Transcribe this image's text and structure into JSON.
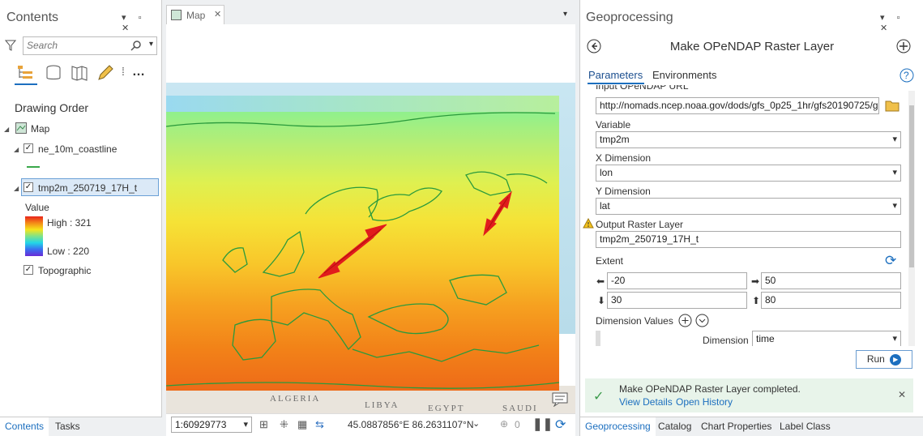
{
  "contents": {
    "title": "Contents",
    "search_placeholder": "Search",
    "drawing_order": "Drawing Order",
    "map_label": "Map",
    "layer1": "ne_10m_coastline",
    "layer2": "tmp2m_250719_17H_t",
    "value_label": "Value",
    "high": "High : 321",
    "low": "Low : 220",
    "layer3": "Topographic",
    "bottom_tabs": [
      "Contents",
      "Tasks"
    ]
  },
  "map": {
    "tab_label": "Map",
    "place_labels": [
      "ALGERIA",
      "LIBYA",
      "EGYPT",
      "SAUDI"
    ],
    "scale": "1:60929773",
    "coords": "45.0887856°E 86.2631107°N",
    "selected_count": "0"
  },
  "geoprocessing": {
    "title": "Geoprocessing",
    "tool_title": "Make OPeNDAP Raster Layer",
    "tabs": [
      "Parameters",
      "Environments"
    ],
    "input_label_partial": "Input OPeNDAP URL",
    "input_url": "http://nomads.ncep.noaa.gov/dods/gfs_0p25_1hr/gfs20190725/g",
    "variable_label": "Variable",
    "variable_value": "tmp2m",
    "xdim_label": "X Dimension",
    "xdim_value": "lon",
    "ydim_label": "Y Dimension",
    "ydim_value": "lat",
    "output_label": "Output Raster Layer",
    "output_value": "tmp2m_250719_17H_t",
    "extent_label": "Extent",
    "west": "-20",
    "east": "50",
    "south": "30",
    "north": "80",
    "dimvalues_label": "Dimension Values",
    "dimension_label": "Dimension",
    "dimension_value": "time",
    "run_label": "Run",
    "status_message": "Make OPeNDAP Raster Layer completed.",
    "view_details": "View Details",
    "open_history": "Open History",
    "bottom_tabs": [
      "Geoprocessing",
      "Catalog",
      "Chart Properties",
      "Label Class"
    ]
  },
  "colors": {
    "accent": "#1c6fbf",
    "success": "#e8f4ea",
    "arrow": "#e11c1c"
  },
  "icons": [
    "filter-icon",
    "search-icon",
    "list-by-drawing-order-icon",
    "database-icon",
    "edit-icon",
    "more-icon",
    "back-icon",
    "add-icon",
    "help-icon",
    "folder-icon",
    "refresh-icon",
    "warning-icon",
    "check-icon",
    "close-icon"
  ]
}
